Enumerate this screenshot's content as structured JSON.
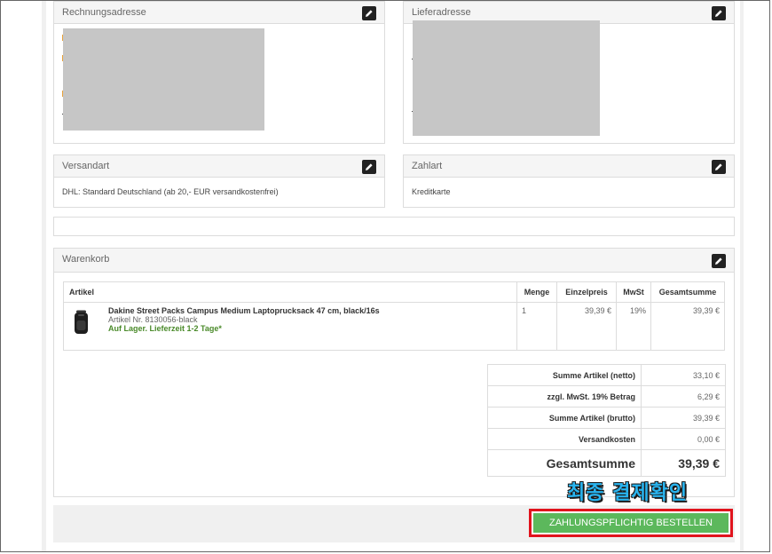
{
  "billing": {
    "title": "Rechnungsadresse"
  },
  "shipping_address": {
    "title": "Lieferadresse"
  },
  "shipping_method": {
    "title": "Versandart",
    "value": "DHL: Standard Deutschland (ab 20,- EUR versandkostenfrei)"
  },
  "payment_method": {
    "title": "Zahlart",
    "value": "Kreditkarte"
  },
  "cart": {
    "title": "Warenkorb",
    "columns": [
      "Artikel",
      "Menge",
      "Einzelpreis",
      "MwSt",
      "Gesamtsumme"
    ],
    "items": [
      {
        "name": "Dakine Street Packs Campus Medium Laptoprucksack 47 cm, black/16s",
        "sku": "Artikel Nr. 8130056-black",
        "stock": "Auf Lager. Lieferzeit 1-2 Tage*",
        "qty": "1",
        "unit_price": "39,39 €",
        "vat": "19%",
        "total": "39,39 €"
      }
    ]
  },
  "totals": {
    "rows": [
      {
        "label": "Summe Artikel (netto)",
        "value": "33,10 €"
      },
      {
        "label": "zzgl. MwSt. 19% Betrag",
        "value": "6,29 €"
      },
      {
        "label": "Summe Artikel (brutto)",
        "value": "39,39 €"
      },
      {
        "label": "Versandkosten",
        "value": "0,00 €"
      }
    ],
    "grand": {
      "label": "Gesamtsumme",
      "value": "39,39 €"
    }
  },
  "annotation": {
    "text": "최종 결제확인",
    "color": "#29b4ef",
    "highlight_color": "#e0141d"
  },
  "order_button": {
    "label": "ZAHLUNGSPFLICHTIG BESTELLEN",
    "color": "#5cb85c"
  },
  "icons": {
    "edit": "pencil-icon",
    "product": "backpack-icon"
  }
}
